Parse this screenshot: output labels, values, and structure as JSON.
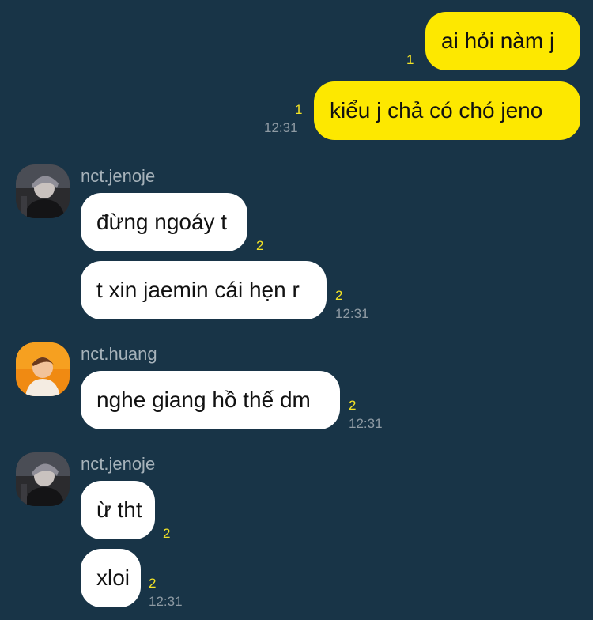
{
  "colors": {
    "background": "#183447",
    "my_bubble": "#fde800",
    "their_bubble": "#ffffff",
    "unread_count": "#f2e226",
    "timestamp": "#8e9aa3",
    "sender_name": "#a6b2ba"
  },
  "messages": [
    {
      "from": "me",
      "text": "ai hỏi nàm j",
      "unread": "1",
      "time": ""
    },
    {
      "from": "me",
      "text": "kiểu j chả có chó jeno",
      "unread": "1",
      "time": "12:31"
    },
    {
      "from": "nct.jenoje",
      "text": "đừng ngoáy t",
      "unread": "2",
      "time": ""
    },
    {
      "from": "nct.jenoje",
      "text": "t xin jaemin cái hẹn r",
      "unread": "2",
      "time": "12:31"
    },
    {
      "from": "nct.huang",
      "text": "nghe giang hồ thế dm",
      "unread": "2",
      "time": "12:31"
    },
    {
      "from": "nct.jenoje",
      "text": "ừ tht",
      "unread": "2",
      "time": ""
    },
    {
      "from": "nct.jenoje",
      "text": "xloi",
      "unread": "2",
      "time": "12:31"
    }
  ],
  "senders": {
    "group1": "nct.jenoje",
    "group2": "nct.huang",
    "group3": "nct.jenoje"
  },
  "avatars": {
    "jenoje": "profile-photo-dark",
    "huang": "profile-photo-orange"
  }
}
